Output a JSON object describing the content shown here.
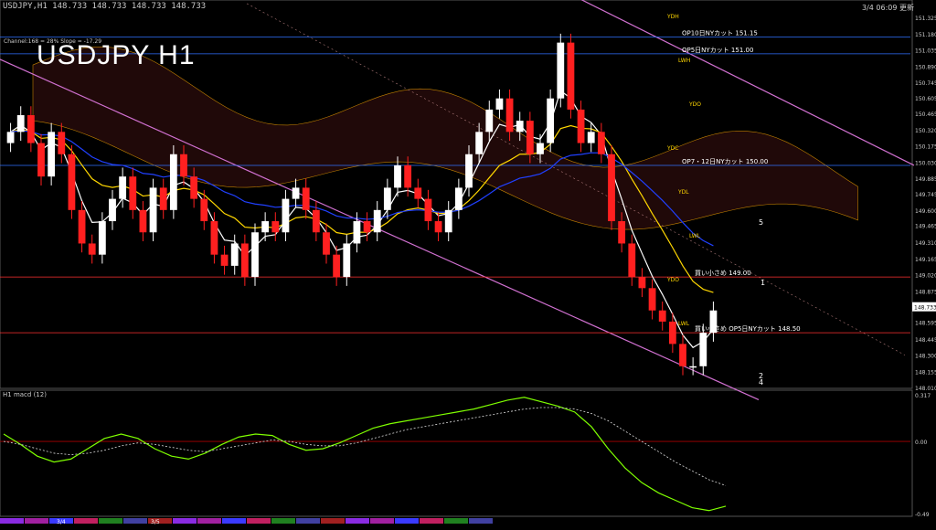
{
  "header": {
    "symbol_line": "USDJPY,H1  148.733 148.733 148.733 148.733",
    "chart_title": "USDJPY H1",
    "clock": "3/4 06:09 更新",
    "param_text": "Channel:168 = 28% Slope = -17.29",
    "indicator_label": "H1 macd (12)"
  },
  "chart_data": {
    "type": "line",
    "title": "USDJPY H1",
    "price_axis": {
      "ticks": [
        "151.325",
        "151.180",
        "151.035",
        "150.890",
        "150.745",
        "150.605",
        "150.465",
        "150.320",
        "150.175",
        "150.030",
        "149.885",
        "149.745",
        "149.600",
        "149.465",
        "149.310",
        "149.165",
        "149.020",
        "148.875",
        "148.733",
        "148.595",
        "148.445",
        "148.300",
        "148.155",
        "148.010"
      ],
      "ylim": [
        148.01,
        151.4
      ],
      "current": "148.733"
    },
    "macd_axis": {
      "ticks": [
        "0.317",
        "0.00",
        "-0.49"
      ],
      "ylim": [
        -0.49,
        0.317
      ]
    },
    "date_labels": [
      "3/4",
      "3/5"
    ],
    "series": [
      {
        "name": "close",
        "values": [
          150.3,
          150.45,
          150.2,
          149.9,
          150.3,
          150.1,
          149.6,
          149.3,
          149.2,
          149.5,
          149.7,
          149.9,
          149.6,
          149.4,
          149.8,
          149.6,
          150.1,
          149.9,
          149.7,
          149.5,
          149.2,
          149.1,
          149.3,
          149.0,
          149.4,
          149.5,
          149.4,
          149.7,
          149.8,
          149.6,
          149.4,
          149.2,
          149.0,
          149.3,
          149.5,
          149.4,
          149.6,
          149.8,
          150.0,
          149.8,
          149.7,
          149.5,
          149.4,
          149.6,
          149.8,
          150.1,
          150.3,
          150.5,
          150.6,
          150.3,
          150.4,
          150.1,
          150.2,
          150.6,
          151.1,
          150.5,
          150.2,
          150.3,
          150.1,
          149.5,
          149.3,
          149.0,
          148.9,
          148.7,
          148.6,
          148.4,
          148.2,
          148.2,
          148.5,
          148.7
        ]
      },
      {
        "name": "macd",
        "values": [
          0.05,
          -0.02,
          -0.1,
          -0.14,
          -0.12,
          -0.05,
          0.02,
          0.05,
          0.02,
          -0.05,
          -0.1,
          -0.12,
          -0.08,
          -0.02,
          0.03,
          0.05,
          0.04,
          -0.02,
          -0.06,
          -0.05,
          -0.01,
          0.04,
          0.09,
          0.12,
          0.14,
          0.16,
          0.18,
          0.2,
          0.22,
          0.25,
          0.28,
          0.3,
          0.27,
          0.24,
          0.2,
          0.1,
          -0.05,
          -0.18,
          -0.28,
          -0.35,
          -0.4,
          -0.45,
          -0.47,
          -0.44
        ]
      },
      {
        "name": "signal",
        "values": [
          0.0,
          -0.02,
          -0.05,
          -0.08,
          -0.09,
          -0.08,
          -0.06,
          -0.03,
          -0.01,
          -0.02,
          -0.04,
          -0.06,
          -0.07,
          -0.05,
          -0.03,
          -0.01,
          0.01,
          0.0,
          -0.02,
          -0.03,
          -0.03,
          -0.01,
          0.02,
          0.05,
          0.08,
          0.1,
          0.12,
          0.14,
          0.16,
          0.18,
          0.2,
          0.22,
          0.23,
          0.23,
          0.22,
          0.19,
          0.14,
          0.07,
          0.0,
          -0.07,
          -0.14,
          -0.2,
          -0.26,
          -0.3
        ]
      }
    ],
    "levels": [
      {
        "label": "OP10日NYカット 151.15",
        "price": 151.15
      },
      {
        "label": "OP5日NYカット 151.00",
        "price": 151.0
      },
      {
        "label": "OP7・12日NYカット 150.00",
        "price": 150.0
      },
      {
        "label": "買い小さめ  149.00",
        "price": 149.0
      },
      {
        "label": "買い小さめ  OP5日NYカット 148.50",
        "price": 148.5
      }
    ],
    "markers": [
      "YDH",
      "LWH",
      "YDO",
      "YDC",
      "YDL",
      "LWL",
      "YDO",
      "LWL"
    ],
    "wave_labels": [
      "5",
      "1",
      "2",
      "4"
    ]
  },
  "colors": {
    "bull": "#ffffff",
    "bear": "#ff2020",
    "ema_fast": "#ffffff",
    "ema_mid": "#ffd700",
    "ema_slow": "#2040ff",
    "channel": "#d070d0",
    "macd": "#7fff00",
    "signal": "#dddddd",
    "cloud": "#b03030"
  }
}
